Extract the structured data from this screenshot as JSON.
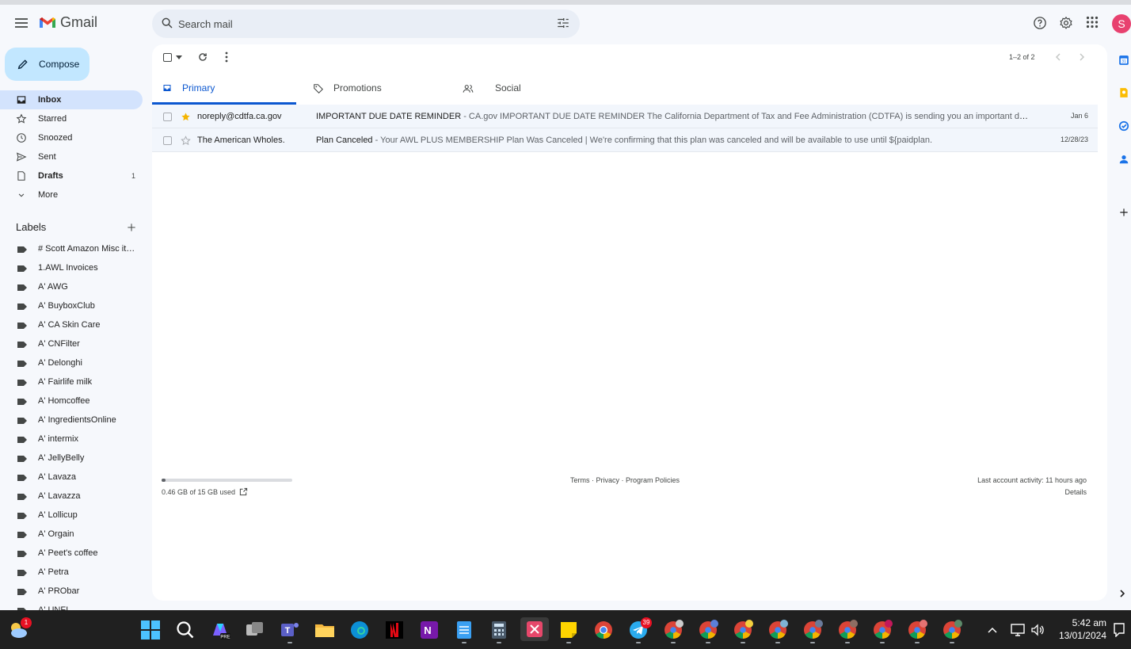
{
  "app": {
    "name": "Gmail"
  },
  "search": {
    "placeholder": "Search mail"
  },
  "avatar_letter": "S",
  "compose_label": "Compose",
  "nav": [
    {
      "label": "Inbox",
      "icon": "inbox-icon",
      "active": true,
      "bold": true,
      "count": ""
    },
    {
      "label": "Starred",
      "icon": "star-icon",
      "count": ""
    },
    {
      "label": "Snoozed",
      "icon": "clock-icon",
      "count": ""
    },
    {
      "label": "Sent",
      "icon": "send-icon",
      "count": ""
    },
    {
      "label": "Drafts",
      "icon": "draft-icon",
      "bold": true,
      "count": "1"
    },
    {
      "label": "More",
      "icon": "chevron-down-icon",
      "count": ""
    }
  ],
  "labels_heading": "Labels",
  "labels": [
    "# Scott Amazon Misc ite...",
    "1.AWL Invoices",
    "A' AWG",
    "A' BuyboxClub",
    "A' CA Skin Care",
    "A' CNFilter",
    "A' Delonghi",
    "A' Fairlife milk",
    "A' Homcoffee",
    "A' IngredientsOnline",
    "A' intermix",
    "A' JellyBelly",
    "A' Lavaza",
    "A' Lavazza",
    "A' Lollicup",
    "A' Orgain",
    "A' Peet's coffee",
    "A' Petra",
    "A' PRObar",
    "A' UNFI"
  ],
  "pager": "1–2 of 2",
  "tabs": [
    {
      "label": "Primary",
      "icon": "inbox-icon",
      "active": true
    },
    {
      "label": "Promotions",
      "icon": "tag-icon"
    },
    {
      "label": "Social",
      "icon": "people-icon"
    }
  ],
  "emails": [
    {
      "sender": "noreply@cdtfa.ca.gov",
      "starred": true,
      "subject": "IMPORTANT DUE DATE REMINDER",
      "preview": " - CA.gov IMPORTANT DUE DATE REMINDER The California Department of Tax and Fee Administration (CDTFA) is sending you an important due date remin...",
      "date": "Jan 6"
    },
    {
      "sender": "The American Wholes.",
      "starred": false,
      "subject": "Plan Canceled",
      "preview": " - Your AWL PLUS MEMBERSHIP Plan Was Canceled | We're confirming that this plan was canceled and will be available to use until ${paidplan.",
      "date": "12/28/23"
    }
  ],
  "footer": {
    "storage_text": "0.46 GB of 15 GB used",
    "storage_fraction": 0.031,
    "terms": "Terms",
    "privacy": "Privacy",
    "policies": "Program Policies",
    "sep": " · ",
    "activity": "Last account activity: 11 hours ago",
    "details": "Details"
  },
  "taskbar": {
    "weather_badge": "1",
    "telegram_badge": "39",
    "time": "5:42 am",
    "date": "13/01/2024"
  },
  "colors": {
    "accent": "#0b57d0",
    "compose_bg": "#c2e7ff",
    "active_nav": "#d3e3fd",
    "avatar": "#e8416f",
    "star": "#f4b400"
  }
}
